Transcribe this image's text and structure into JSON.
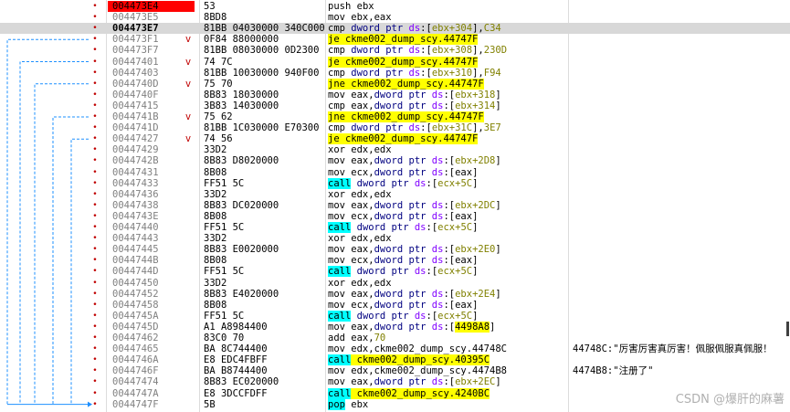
{
  "colors": {
    "eip_marker": "#ff0000",
    "current_row": "#d8d8d8",
    "jump_highlight": "#ffff00",
    "call_highlight": "#00ffff",
    "arrow": "#1e90ff",
    "breakpoint_dot": "#c00000"
  },
  "watermark": "CSDN @爆肝的麻薯",
  "rows": [
    {
      "addr": "004473E4",
      "mark": "",
      "bytes": "53",
      "asm": [
        [
          "push",
          "n"
        ],
        [
          " ebx",
          "r"
        ]
      ],
      "comment": "",
      "eip": true
    },
    {
      "addr": "004473E5",
      "mark": "",
      "bytes": "8BD8",
      "asm": [
        [
          "mov",
          "n"
        ],
        [
          " ebx,eax",
          "r"
        ]
      ],
      "comment": ""
    },
    {
      "addr": "004473E7",
      "mark": "",
      "bytes": "81BB 04030000 340C000",
      "asm": [
        [
          "cmp",
          "n"
        ],
        [
          " dword ptr ",
          "k"
        ],
        [
          "ds",
          "s"
        ],
        [
          ":[",
          "r"
        ],
        [
          "ebx+304",
          "u"
        ],
        [
          "],",
          "r"
        ],
        [
          "C34",
          "u"
        ]
      ],
      "comment": "",
      "current": true
    },
    {
      "addr": "004473F1",
      "mark": "v",
      "bytes": "0F84 88000000",
      "asm": [
        [
          "je",
          "y"
        ],
        [
          " ckme002_dump_scy.44747F",
          "y"
        ]
      ],
      "comment": ""
    },
    {
      "addr": "004473F7",
      "mark": "",
      "bytes": "81BB 08030000 0D2300",
      "asm": [
        [
          "cmp",
          "n"
        ],
        [
          " dword ptr ",
          "k"
        ],
        [
          "ds",
          "s"
        ],
        [
          ":[",
          "r"
        ],
        [
          "ebx+308",
          "u"
        ],
        [
          "],",
          "r"
        ],
        [
          "230D",
          "u"
        ]
      ],
      "comment": ""
    },
    {
      "addr": "00447401",
      "mark": "v",
      "bytes": "74 7C",
      "asm": [
        [
          "je",
          "y"
        ],
        [
          " ckme002_dump_scy.44747F",
          "y"
        ]
      ],
      "comment": ""
    },
    {
      "addr": "00447403",
      "mark": "",
      "bytes": "81BB 10030000 940F00",
      "asm": [
        [
          "cmp",
          "n"
        ],
        [
          " dword ptr ",
          "k"
        ],
        [
          "ds",
          "s"
        ],
        [
          ":[",
          "r"
        ],
        [
          "ebx+310",
          "u"
        ],
        [
          "],",
          "r"
        ],
        [
          "F94",
          "u"
        ]
      ],
      "comment": ""
    },
    {
      "addr": "0044740D",
      "mark": "v",
      "bytes": "75 70",
      "asm": [
        [
          "jne",
          "y"
        ],
        [
          " ckme002_dump_scy.44747F",
          "y"
        ]
      ],
      "comment": ""
    },
    {
      "addr": "0044740F",
      "mark": "",
      "bytes": "8B83 18030000",
      "asm": [
        [
          "mov",
          "n"
        ],
        [
          " eax,",
          "r"
        ],
        [
          "dword ptr ",
          "k"
        ],
        [
          "ds",
          "s"
        ],
        [
          ":[",
          "r"
        ],
        [
          "ebx+318",
          "u"
        ],
        [
          "]",
          "r"
        ]
      ],
      "comment": ""
    },
    {
      "addr": "00447415",
      "mark": "",
      "bytes": "3B83 14030000",
      "asm": [
        [
          "cmp",
          "n"
        ],
        [
          " eax,",
          "r"
        ],
        [
          "dword ptr ",
          "k"
        ],
        [
          "ds",
          "s"
        ],
        [
          ":[",
          "r"
        ],
        [
          "ebx+314",
          "u"
        ],
        [
          "]",
          "r"
        ]
      ],
      "comment": ""
    },
    {
      "addr": "0044741B",
      "mark": "v",
      "bytes": "75 62",
      "asm": [
        [
          "jne",
          "y"
        ],
        [
          " ckme002_dump_scy.44747F",
          "y"
        ]
      ],
      "comment": ""
    },
    {
      "addr": "0044741D",
      "mark": "",
      "bytes": "81BB 1C030000 E70300",
      "asm": [
        [
          "cmp",
          "n"
        ],
        [
          " dword ptr ",
          "k"
        ],
        [
          "ds",
          "s"
        ],
        [
          ":[",
          "r"
        ],
        [
          "ebx+31C",
          "u"
        ],
        [
          "],",
          "r"
        ],
        [
          "3E7",
          "u"
        ]
      ],
      "comment": ""
    },
    {
      "addr": "00447427",
      "mark": "v",
      "bytes": "74 56",
      "asm": [
        [
          "je",
          "y"
        ],
        [
          " ckme002_dump_scy.44747F",
          "y"
        ]
      ],
      "comment": ""
    },
    {
      "addr": "00447429",
      "mark": "",
      "bytes": "33D2",
      "asm": [
        [
          "xor",
          "n"
        ],
        [
          " edx,edx",
          "r"
        ]
      ],
      "comment": ""
    },
    {
      "addr": "0044742B",
      "mark": "",
      "bytes": "8B83 D8020000",
      "asm": [
        [
          "mov",
          "n"
        ],
        [
          " eax,",
          "r"
        ],
        [
          "dword ptr ",
          "k"
        ],
        [
          "ds",
          "s"
        ],
        [
          ":[",
          "r"
        ],
        [
          "ebx+2D8",
          "u"
        ],
        [
          "]",
          "r"
        ]
      ],
      "comment": ""
    },
    {
      "addr": "00447431",
      "mark": "",
      "bytes": "8B08",
      "asm": [
        [
          "mov",
          "n"
        ],
        [
          " ecx,",
          "r"
        ],
        [
          "dword ptr ",
          "k"
        ],
        [
          "ds",
          "s"
        ],
        [
          ":[",
          "r"
        ],
        [
          "eax",
          "r"
        ],
        [
          "]",
          "r"
        ]
      ],
      "comment": ""
    },
    {
      "addr": "00447433",
      "mark": "",
      "bytes": "FF51 5C",
      "asm": [
        [
          "call",
          "c"
        ],
        [
          " dword ptr ",
          "k"
        ],
        [
          "ds",
          "s"
        ],
        [
          ":[",
          "r"
        ],
        [
          "ecx+5C",
          "u"
        ],
        [
          "]",
          "r"
        ]
      ],
      "comment": ""
    },
    {
      "addr": "00447436",
      "mark": "",
      "bytes": "33D2",
      "asm": [
        [
          "xor",
          "n"
        ],
        [
          " edx,edx",
          "r"
        ]
      ],
      "comment": ""
    },
    {
      "addr": "00447438",
      "mark": "",
      "bytes": "8B83 DC020000",
      "asm": [
        [
          "mov",
          "n"
        ],
        [
          " eax,",
          "r"
        ],
        [
          "dword ptr ",
          "k"
        ],
        [
          "ds",
          "s"
        ],
        [
          ":[",
          "r"
        ],
        [
          "ebx+2DC",
          "u"
        ],
        [
          "]",
          "r"
        ]
      ],
      "comment": ""
    },
    {
      "addr": "0044743E",
      "mark": "",
      "bytes": "8B08",
      "asm": [
        [
          "mov",
          "n"
        ],
        [
          " ecx,",
          "r"
        ],
        [
          "dword ptr ",
          "k"
        ],
        [
          "ds",
          "s"
        ],
        [
          ":[",
          "r"
        ],
        [
          "eax",
          "r"
        ],
        [
          "]",
          "r"
        ]
      ],
      "comment": ""
    },
    {
      "addr": "00447440",
      "mark": "",
      "bytes": "FF51 5C",
      "asm": [
        [
          "call",
          "c"
        ],
        [
          " dword ptr ",
          "k"
        ],
        [
          "ds",
          "s"
        ],
        [
          ":[",
          "r"
        ],
        [
          "ecx+5C",
          "u"
        ],
        [
          "]",
          "r"
        ]
      ],
      "comment": ""
    },
    {
      "addr": "00447443",
      "mark": "",
      "bytes": "33D2",
      "asm": [
        [
          "xor",
          "n"
        ],
        [
          " edx,edx",
          "r"
        ]
      ],
      "comment": ""
    },
    {
      "addr": "00447445",
      "mark": "",
      "bytes": "8B83 E0020000",
      "asm": [
        [
          "mov",
          "n"
        ],
        [
          " eax,",
          "r"
        ],
        [
          "dword ptr ",
          "k"
        ],
        [
          "ds",
          "s"
        ],
        [
          ":[",
          "r"
        ],
        [
          "ebx+2E0",
          "u"
        ],
        [
          "]",
          "r"
        ]
      ],
      "comment": ""
    },
    {
      "addr": "0044744B",
      "mark": "",
      "bytes": "8B08",
      "asm": [
        [
          "mov",
          "n"
        ],
        [
          " ecx,",
          "r"
        ],
        [
          "dword ptr ",
          "k"
        ],
        [
          "ds",
          "s"
        ],
        [
          ":[",
          "r"
        ],
        [
          "eax",
          "r"
        ],
        [
          "]",
          "r"
        ]
      ],
      "comment": ""
    },
    {
      "addr": "0044744D",
      "mark": "",
      "bytes": "FF51 5C",
      "asm": [
        [
          "call",
          "c"
        ],
        [
          " dword ptr ",
          "k"
        ],
        [
          "ds",
          "s"
        ],
        [
          ":[",
          "r"
        ],
        [
          "ecx+5C",
          "u"
        ],
        [
          "]",
          "r"
        ]
      ],
      "comment": ""
    },
    {
      "addr": "00447450",
      "mark": "",
      "bytes": "33D2",
      "asm": [
        [
          "xor",
          "n"
        ],
        [
          " edx,edx",
          "r"
        ]
      ],
      "comment": ""
    },
    {
      "addr": "00447452",
      "mark": "",
      "bytes": "8B83 E4020000",
      "asm": [
        [
          "mov",
          "n"
        ],
        [
          " eax,",
          "r"
        ],
        [
          "dword ptr ",
          "k"
        ],
        [
          "ds",
          "s"
        ],
        [
          ":[",
          "r"
        ],
        [
          "ebx+2E4",
          "u"
        ],
        [
          "]",
          "r"
        ]
      ],
      "comment": ""
    },
    {
      "addr": "00447458",
      "mark": "",
      "bytes": "8B08",
      "asm": [
        [
          "mov",
          "n"
        ],
        [
          " ecx,",
          "r"
        ],
        [
          "dword ptr ",
          "k"
        ],
        [
          "ds",
          "s"
        ],
        [
          ":[",
          "r"
        ],
        [
          "eax",
          "r"
        ],
        [
          "]",
          "r"
        ]
      ],
      "comment": ""
    },
    {
      "addr": "0044745A",
      "mark": "",
      "bytes": "FF51 5C",
      "asm": [
        [
          "call",
          "c"
        ],
        [
          " dword ptr ",
          "k"
        ],
        [
          "ds",
          "s"
        ],
        [
          ":[",
          "r"
        ],
        [
          "ecx+5C",
          "u"
        ],
        [
          "]",
          "r"
        ]
      ],
      "comment": ""
    },
    {
      "addr": "0044745D",
      "mark": "",
      "bytes": "A1 A8984400",
      "asm": [
        [
          "mov",
          "n"
        ],
        [
          " eax,",
          "r"
        ],
        [
          "dword ptr ",
          "k"
        ],
        [
          "ds",
          "s"
        ],
        [
          ":[",
          "r"
        ],
        [
          "4498A8",
          "y"
        ],
        [
          "]",
          "r"
        ]
      ],
      "comment": ""
    },
    {
      "addr": "00447462",
      "mark": "",
      "bytes": "83C0 70",
      "asm": [
        [
          "add",
          "n"
        ],
        [
          " eax,",
          "r"
        ],
        [
          "70",
          "u"
        ]
      ],
      "comment": ""
    },
    {
      "addr": "00447465",
      "mark": "",
      "bytes": "BA 8C744400",
      "asm": [
        [
          "mov",
          "n"
        ],
        [
          " edx,ckme002_dump_scy.44748C",
          "r"
        ]
      ],
      "comment": "44748C:\"厉害厉害真厉害！佩服佩服真佩服！"
    },
    {
      "addr": "0044746A",
      "mark": "",
      "bytes": "E8 EDC4FBFF",
      "asm": [
        [
          "call",
          "c"
        ],
        [
          " ckme002_dump_scy.40395C",
          "y"
        ]
      ],
      "comment": ""
    },
    {
      "addr": "0044746F",
      "mark": "",
      "bytes": "BA B8744400",
      "asm": [
        [
          "mov",
          "n"
        ],
        [
          " edx,ckme002_dump_scy.4474B8",
          "r"
        ]
      ],
      "comment": "4474B8:\"注册了\""
    },
    {
      "addr": "00447474",
      "mark": "",
      "bytes": "8B83 EC020000",
      "asm": [
        [
          "mov",
          "n"
        ],
        [
          " eax,",
          "r"
        ],
        [
          "dword ptr ",
          "k"
        ],
        [
          "ds",
          "s"
        ],
        [
          ":[",
          "r"
        ],
        [
          "ebx+2EC",
          "u"
        ],
        [
          "]",
          "r"
        ]
      ],
      "comment": ""
    },
    {
      "addr": "0044747A",
      "mark": "",
      "bytes": "E8 3DCCFDFF",
      "asm": [
        [
          "call",
          "c"
        ],
        [
          " ckme002_dump_scy.4240BC",
          "y"
        ]
      ],
      "comment": ""
    },
    {
      "addr": "0044747F",
      "mark": "",
      "bytes": "5B",
      "asm": [
        [
          "pop",
          "c"
        ],
        [
          " ebx",
          "r"
        ]
      ],
      "comment": ""
    }
  ]
}
